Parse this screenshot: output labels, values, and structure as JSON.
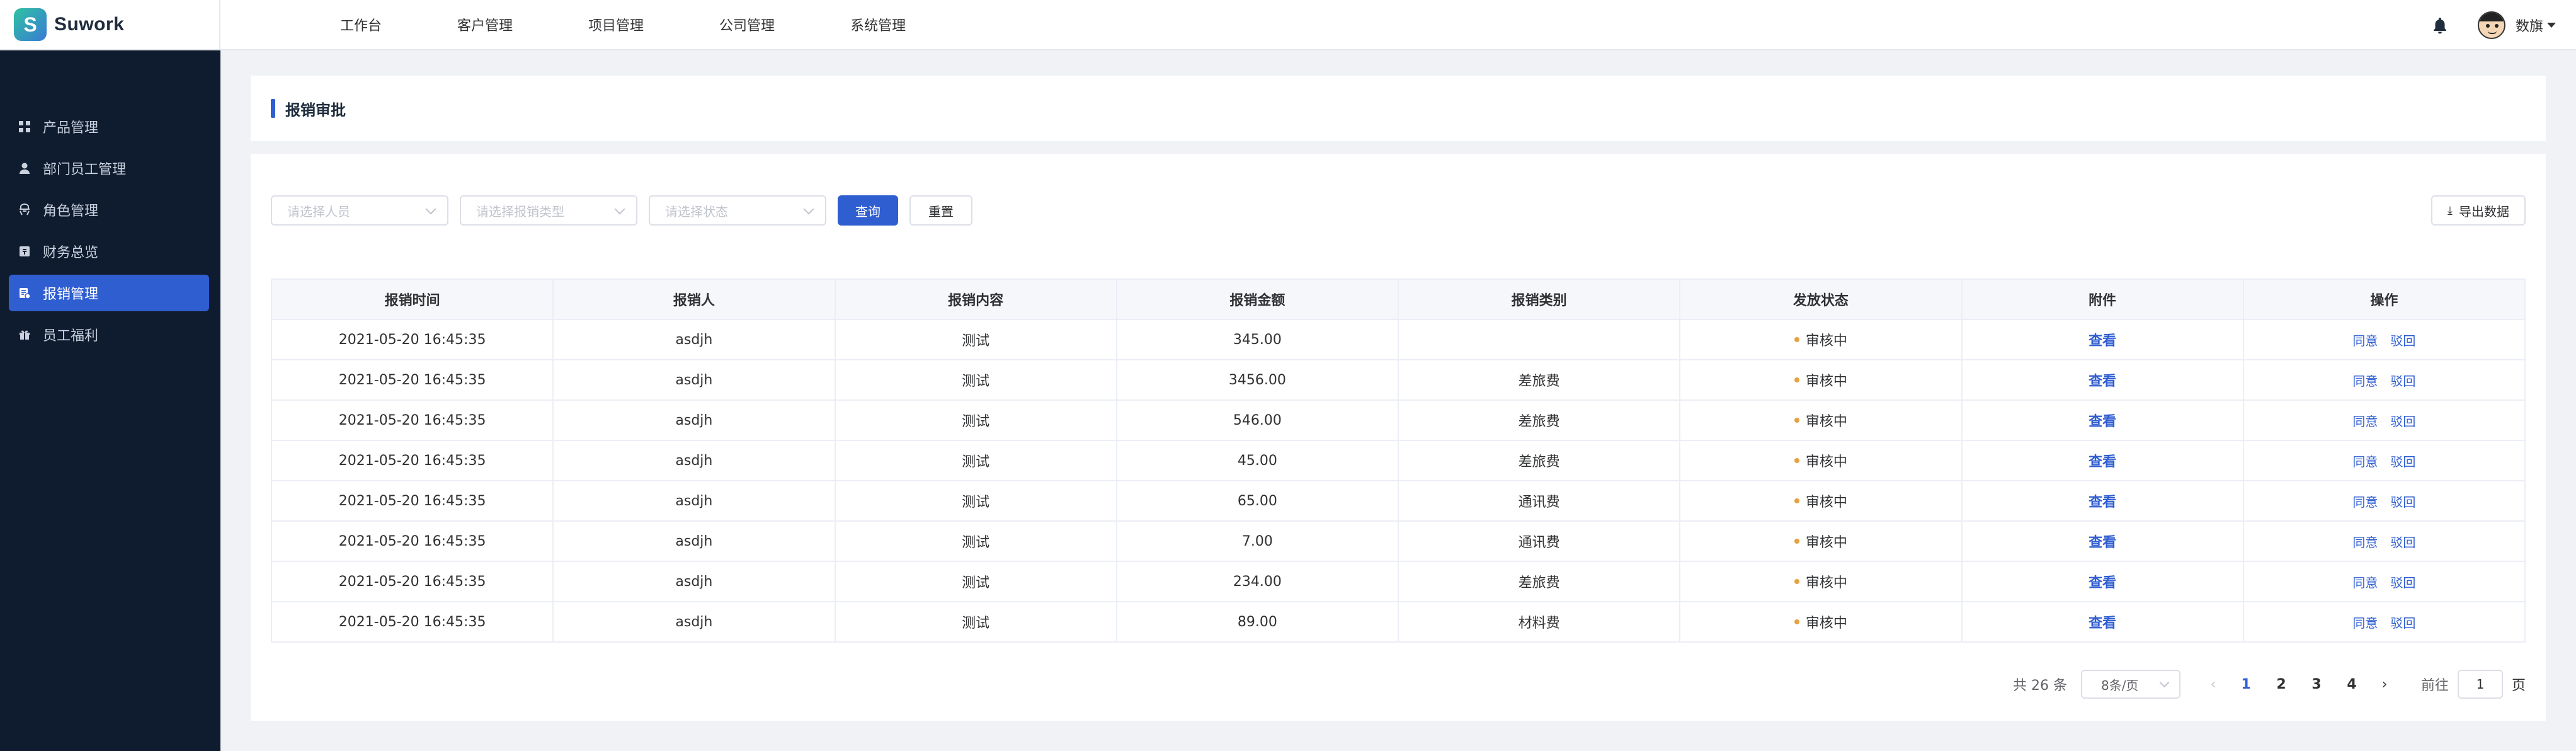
{
  "app": {
    "name": "Suwork",
    "logo_letter": "S"
  },
  "topnav": [
    "工作台",
    "客户管理",
    "项目管理",
    "公司管理",
    "系统管理"
  ],
  "user": {
    "name": "数旗"
  },
  "sidebar": {
    "items": [
      {
        "label": "产品管理",
        "icon": "grid-icon"
      },
      {
        "label": "部门员工管理",
        "icon": "user-icon"
      },
      {
        "label": "角色管理",
        "icon": "role-icon"
      },
      {
        "label": "财务总览",
        "icon": "finance-icon"
      },
      {
        "label": "报销管理",
        "icon": "receipt-icon",
        "active": true
      },
      {
        "label": "员工福利",
        "icon": "gift-icon"
      }
    ]
  },
  "page": {
    "title": "报销审批"
  },
  "filters": {
    "person_placeholder": "请选择人员",
    "type_placeholder": "请选择报销类型",
    "status_placeholder": "请选择状态",
    "query_label": "查询",
    "reset_label": "重置",
    "export_label": "导出数据"
  },
  "table": {
    "columns": [
      "报销时间",
      "报销人",
      "报销内容",
      "报销金额",
      "报销类别",
      "发放状态",
      "附件",
      "操作"
    ],
    "rows": [
      {
        "time": "2021-05-20 16:45:35",
        "person": "asdjh",
        "content": "测试",
        "amount": "345.00",
        "category": "",
        "status": "审核中",
        "attachment": "查看",
        "approve": "同意",
        "reject": "驳回"
      },
      {
        "time": "2021-05-20 16:45:35",
        "person": "asdjh",
        "content": "测试",
        "amount": "3456.00",
        "category": "差旅费",
        "status": "审核中",
        "attachment": "查看",
        "approve": "同意",
        "reject": "驳回"
      },
      {
        "time": "2021-05-20 16:45:35",
        "person": "asdjh",
        "content": "测试",
        "amount": "546.00",
        "category": "差旅费",
        "status": "审核中",
        "attachment": "查看",
        "approve": "同意",
        "reject": "驳回"
      },
      {
        "time": "2021-05-20 16:45:35",
        "person": "asdjh",
        "content": "测试",
        "amount": "45.00",
        "category": "差旅费",
        "status": "审核中",
        "attachment": "查看",
        "approve": "同意",
        "reject": "驳回"
      },
      {
        "time": "2021-05-20 16:45:35",
        "person": "asdjh",
        "content": "测试",
        "amount": "65.00",
        "category": "通讯费",
        "status": "审核中",
        "attachment": "查看",
        "approve": "同意",
        "reject": "驳回"
      },
      {
        "time": "2021-05-20 16:45:35",
        "person": "asdjh",
        "content": "测试",
        "amount": "7.00",
        "category": "通讯费",
        "status": "审核中",
        "attachment": "查看",
        "approve": "同意",
        "reject": "驳回"
      },
      {
        "time": "2021-05-20 16:45:35",
        "person": "asdjh",
        "content": "测试",
        "amount": "234.00",
        "category": "差旅费",
        "status": "审核中",
        "attachment": "查看",
        "approve": "同意",
        "reject": "驳回"
      },
      {
        "time": "2021-05-20 16:45:35",
        "person": "asdjh",
        "content": "测试",
        "amount": "89.00",
        "category": "材料费",
        "status": "审核中",
        "attachment": "查看",
        "approve": "同意",
        "reject": "驳回"
      }
    ]
  },
  "pagination": {
    "total_text": "共 26 条",
    "page_size": "8条/页",
    "pages": [
      "1",
      "2",
      "3",
      "4"
    ],
    "current_page": "1",
    "goto_prefix": "前往",
    "goto_value": "1",
    "goto_suffix": "页"
  },
  "colors": {
    "primary": "#2f5ed1",
    "sidebar_bg": "#0f1c2f",
    "status_dot": "#e6a23c"
  }
}
